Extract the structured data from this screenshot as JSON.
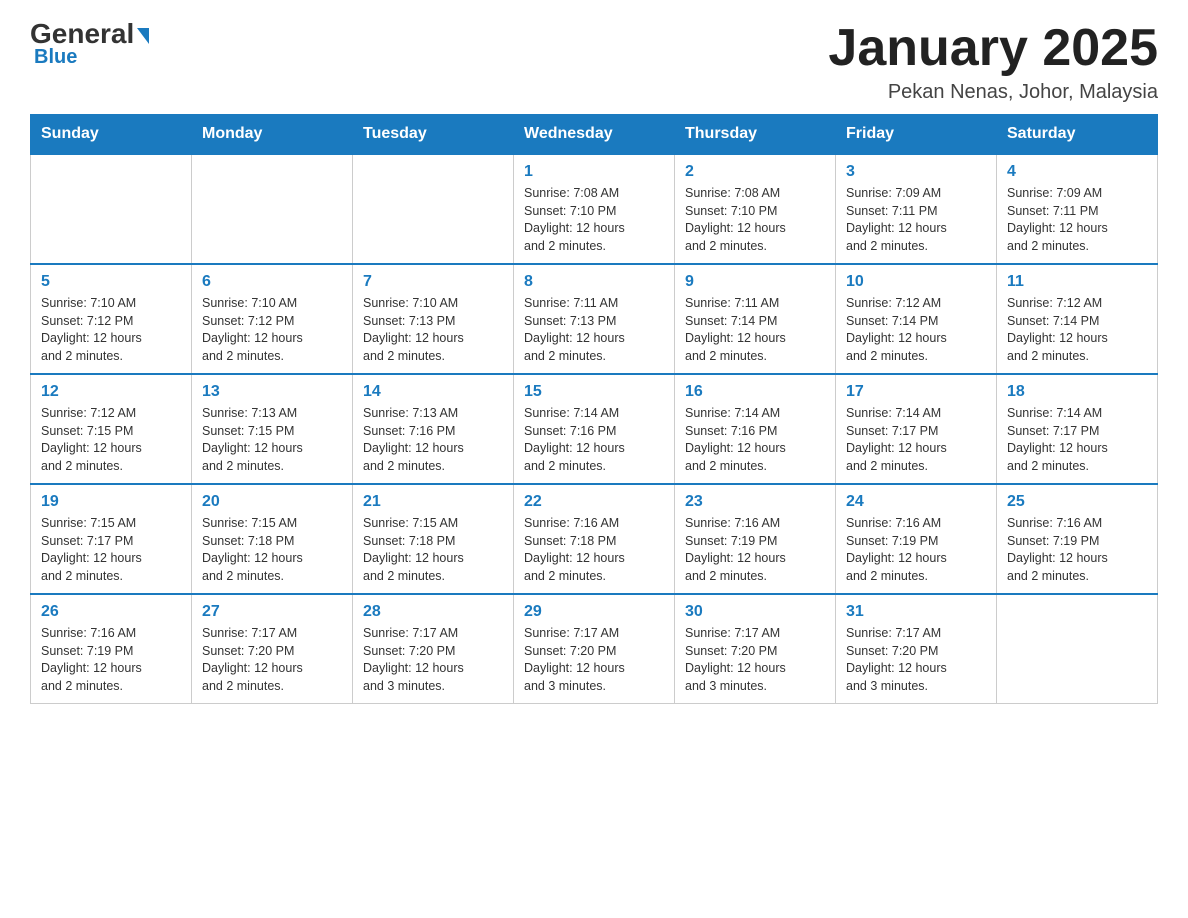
{
  "logo": {
    "text_general": "General",
    "text_blue": "Blue"
  },
  "header": {
    "title": "January 2025",
    "subtitle": "Pekan Nenas, Johor, Malaysia"
  },
  "days_of_week": [
    "Sunday",
    "Monday",
    "Tuesday",
    "Wednesday",
    "Thursday",
    "Friday",
    "Saturday"
  ],
  "weeks": [
    [
      {
        "num": "",
        "info": ""
      },
      {
        "num": "",
        "info": ""
      },
      {
        "num": "",
        "info": ""
      },
      {
        "num": "1",
        "info": "Sunrise: 7:08 AM\nSunset: 7:10 PM\nDaylight: 12 hours\nand 2 minutes."
      },
      {
        "num": "2",
        "info": "Sunrise: 7:08 AM\nSunset: 7:10 PM\nDaylight: 12 hours\nand 2 minutes."
      },
      {
        "num": "3",
        "info": "Sunrise: 7:09 AM\nSunset: 7:11 PM\nDaylight: 12 hours\nand 2 minutes."
      },
      {
        "num": "4",
        "info": "Sunrise: 7:09 AM\nSunset: 7:11 PM\nDaylight: 12 hours\nand 2 minutes."
      }
    ],
    [
      {
        "num": "5",
        "info": "Sunrise: 7:10 AM\nSunset: 7:12 PM\nDaylight: 12 hours\nand 2 minutes."
      },
      {
        "num": "6",
        "info": "Sunrise: 7:10 AM\nSunset: 7:12 PM\nDaylight: 12 hours\nand 2 minutes."
      },
      {
        "num": "7",
        "info": "Sunrise: 7:10 AM\nSunset: 7:13 PM\nDaylight: 12 hours\nand 2 minutes."
      },
      {
        "num": "8",
        "info": "Sunrise: 7:11 AM\nSunset: 7:13 PM\nDaylight: 12 hours\nand 2 minutes."
      },
      {
        "num": "9",
        "info": "Sunrise: 7:11 AM\nSunset: 7:14 PM\nDaylight: 12 hours\nand 2 minutes."
      },
      {
        "num": "10",
        "info": "Sunrise: 7:12 AM\nSunset: 7:14 PM\nDaylight: 12 hours\nand 2 minutes."
      },
      {
        "num": "11",
        "info": "Sunrise: 7:12 AM\nSunset: 7:14 PM\nDaylight: 12 hours\nand 2 minutes."
      }
    ],
    [
      {
        "num": "12",
        "info": "Sunrise: 7:12 AM\nSunset: 7:15 PM\nDaylight: 12 hours\nand 2 minutes."
      },
      {
        "num": "13",
        "info": "Sunrise: 7:13 AM\nSunset: 7:15 PM\nDaylight: 12 hours\nand 2 minutes."
      },
      {
        "num": "14",
        "info": "Sunrise: 7:13 AM\nSunset: 7:16 PM\nDaylight: 12 hours\nand 2 minutes."
      },
      {
        "num": "15",
        "info": "Sunrise: 7:14 AM\nSunset: 7:16 PM\nDaylight: 12 hours\nand 2 minutes."
      },
      {
        "num": "16",
        "info": "Sunrise: 7:14 AM\nSunset: 7:16 PM\nDaylight: 12 hours\nand 2 minutes."
      },
      {
        "num": "17",
        "info": "Sunrise: 7:14 AM\nSunset: 7:17 PM\nDaylight: 12 hours\nand 2 minutes."
      },
      {
        "num": "18",
        "info": "Sunrise: 7:14 AM\nSunset: 7:17 PM\nDaylight: 12 hours\nand 2 minutes."
      }
    ],
    [
      {
        "num": "19",
        "info": "Sunrise: 7:15 AM\nSunset: 7:17 PM\nDaylight: 12 hours\nand 2 minutes."
      },
      {
        "num": "20",
        "info": "Sunrise: 7:15 AM\nSunset: 7:18 PM\nDaylight: 12 hours\nand 2 minutes."
      },
      {
        "num": "21",
        "info": "Sunrise: 7:15 AM\nSunset: 7:18 PM\nDaylight: 12 hours\nand 2 minutes."
      },
      {
        "num": "22",
        "info": "Sunrise: 7:16 AM\nSunset: 7:18 PM\nDaylight: 12 hours\nand 2 minutes."
      },
      {
        "num": "23",
        "info": "Sunrise: 7:16 AM\nSunset: 7:19 PM\nDaylight: 12 hours\nand 2 minutes."
      },
      {
        "num": "24",
        "info": "Sunrise: 7:16 AM\nSunset: 7:19 PM\nDaylight: 12 hours\nand 2 minutes."
      },
      {
        "num": "25",
        "info": "Sunrise: 7:16 AM\nSunset: 7:19 PM\nDaylight: 12 hours\nand 2 minutes."
      }
    ],
    [
      {
        "num": "26",
        "info": "Sunrise: 7:16 AM\nSunset: 7:19 PM\nDaylight: 12 hours\nand 2 minutes."
      },
      {
        "num": "27",
        "info": "Sunrise: 7:17 AM\nSunset: 7:20 PM\nDaylight: 12 hours\nand 2 minutes."
      },
      {
        "num": "28",
        "info": "Sunrise: 7:17 AM\nSunset: 7:20 PM\nDaylight: 12 hours\nand 3 minutes."
      },
      {
        "num": "29",
        "info": "Sunrise: 7:17 AM\nSunset: 7:20 PM\nDaylight: 12 hours\nand 3 minutes."
      },
      {
        "num": "30",
        "info": "Sunrise: 7:17 AM\nSunset: 7:20 PM\nDaylight: 12 hours\nand 3 minutes."
      },
      {
        "num": "31",
        "info": "Sunrise: 7:17 AM\nSunset: 7:20 PM\nDaylight: 12 hours\nand 3 minutes."
      },
      {
        "num": "",
        "info": ""
      }
    ]
  ]
}
